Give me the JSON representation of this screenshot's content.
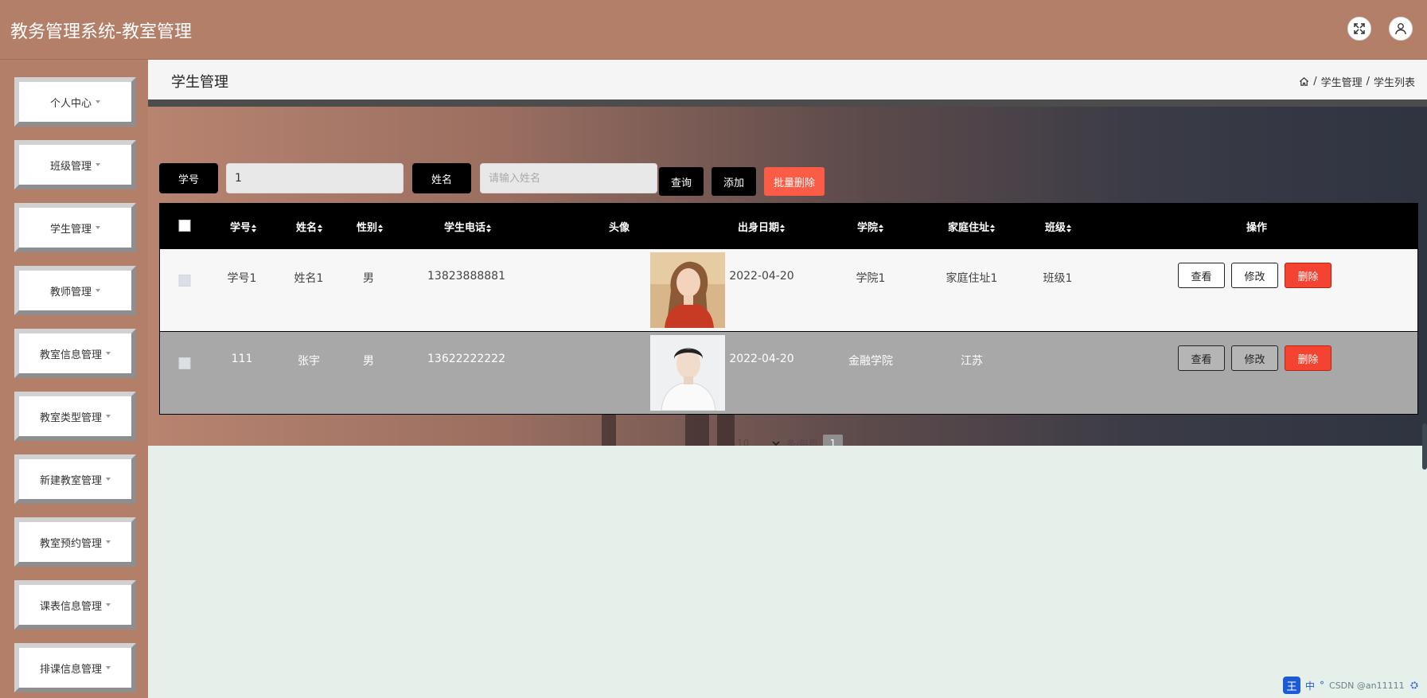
{
  "app": {
    "title": "教务管理系统-教室管理"
  },
  "header": {
    "fullscreen_icon": "fullscreen-icon",
    "user_icon": "user-icon"
  },
  "sidebar": {
    "items": [
      {
        "label": "个人中心"
      },
      {
        "label": "班级管理"
      },
      {
        "label": "学生管理"
      },
      {
        "label": "教师管理"
      },
      {
        "label": "教室信息管理"
      },
      {
        "label": "教室类型管理"
      },
      {
        "label": "新建教室管理"
      },
      {
        "label": "教室预约管理"
      },
      {
        "label": "课表信息管理"
      },
      {
        "label": "排课信息管理"
      }
    ]
  },
  "page": {
    "title": "学生管理",
    "breadcrumb": {
      "home_icon": "home-icon",
      "sep": "/",
      "level1": "学生管理",
      "level2": "学生列表"
    }
  },
  "search": {
    "id_label": "学号",
    "id_value": "1",
    "name_label": "姓名",
    "name_placeholder": "请输入姓名",
    "query_button": "查询",
    "add_button": "添加",
    "batch_delete_button": "批量删除"
  },
  "table": {
    "columns": {
      "student_id": "学号",
      "name": "姓名",
      "gender": "性别",
      "phone": "学生电话",
      "avatar": "头像",
      "birth_date": "出身日期",
      "college": "学院",
      "address": "家庭住址",
      "class": "班级",
      "actions": "操作"
    },
    "rows": [
      {
        "student_id": "学号1",
        "name": "姓名1",
        "gender": "男",
        "phone": "13823888881",
        "birth_date": "2022-04-20",
        "college": "学院1",
        "address": "家庭住址1",
        "class": "班级1",
        "view": "查看",
        "edit": "修改",
        "delete": "删除"
      },
      {
        "student_id": "111",
        "name": "张宇",
        "gender": "男",
        "phone": "13622222222",
        "birth_date": "2022-04-20",
        "college": "金融学院",
        "address": "江苏",
        "class": "",
        "view": "查看",
        "edit": "修改",
        "delete": "删除"
      }
    ]
  },
  "pagination": {
    "page_size": "10",
    "per_page_text": "条/每页",
    "current_page": "1"
  },
  "tray": {
    "ime_badge": "王",
    "ime_mode": "中",
    "symbol": "°",
    "watermark": "CSDN @an11111"
  },
  "colors": {
    "header_bg": "#b37f69",
    "delete_red": "#f44431",
    "batch_delete": "#fb5c46",
    "content_bg": "#e5f0eb",
    "table_head": "#000000"
  }
}
